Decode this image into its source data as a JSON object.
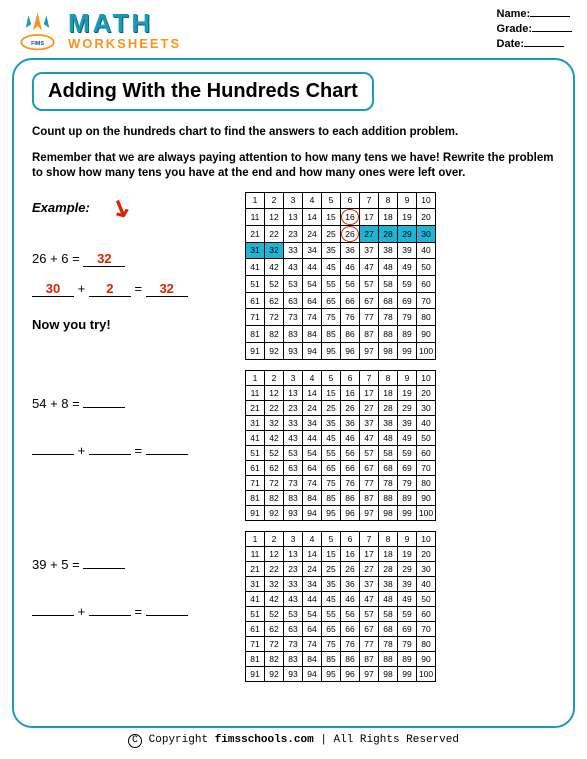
{
  "header": {
    "math": "MATH",
    "worksheets": "WORKSHEETS",
    "name_lbl": "Name:",
    "grade_lbl": "Grade:",
    "date_lbl": "Date:"
  },
  "title": "Adding With the Hundreds Chart",
  "instr1": "Count up on the hundreds chart to find the answers to each addition problem.",
  "instr2": "Remember that we are always paying attention to how many tens we have! Rewrite the problem to show how many tens you have at the end and how many ones were left over.",
  "example_lbl": "Example:",
  "ex": {
    "problem": "26 + 6 =",
    "answer": "32",
    "tens": "30",
    "ones": "2",
    "sum": "32"
  },
  "try_lbl": "Now you try!",
  "p1": {
    "problem": "54 + 8 =",
    "answer": "",
    "tens": "",
    "ones": "",
    "sum": ""
  },
  "p2": {
    "problem": "39 + 5 =",
    "answer": "",
    "tens": "",
    "ones": "",
    "sum": ""
  },
  "plus": "+",
  "eq": "=",
  "footer": {
    "copy": "Copyright",
    "site": "fimsschools.com",
    "rights": "| All Rights Reserved"
  },
  "chart_data": {
    "type": "table",
    "range": [
      1,
      100
    ],
    "highlighted": [
      27,
      28,
      29,
      30,
      31,
      32
    ],
    "circled": [
      26,
      16
    ]
  }
}
